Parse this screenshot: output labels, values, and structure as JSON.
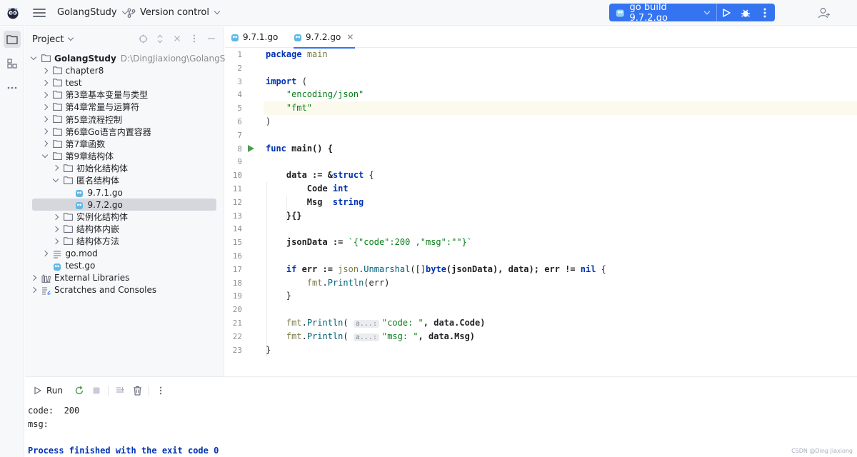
{
  "titlebar": {
    "project_name": "GolangStudy",
    "vcs_label": "Version control",
    "run_config": "go build 9.7.2.go"
  },
  "project_panel": {
    "title": "Project",
    "tree": [
      {
        "label": "GolangStudy",
        "hint": "D:\\DingJiaxiong\\GolangStudy",
        "level": 0,
        "kind": "folder",
        "state": "expanded"
      },
      {
        "label": "chapter8",
        "level": 1,
        "kind": "folder",
        "state": "collapsed"
      },
      {
        "label": "test",
        "level": 1,
        "kind": "folder",
        "state": "collapsed"
      },
      {
        "label": "第3章基本变量与类型",
        "level": 1,
        "kind": "folder",
        "state": "collapsed"
      },
      {
        "label": "第4章常量与运算符",
        "level": 1,
        "kind": "folder",
        "state": "collapsed"
      },
      {
        "label": "第5章流程控制",
        "level": 1,
        "kind": "folder",
        "state": "collapsed"
      },
      {
        "label": "第6章Go语言内置容器",
        "level": 1,
        "kind": "folder",
        "state": "collapsed"
      },
      {
        "label": "第7章函数",
        "level": 1,
        "kind": "folder",
        "state": "collapsed"
      },
      {
        "label": "第9章结构体",
        "level": 1,
        "kind": "folder",
        "state": "expanded"
      },
      {
        "label": "初始化结构体",
        "level": 2,
        "kind": "folder",
        "state": "collapsed"
      },
      {
        "label": "匿名结构体",
        "level": 2,
        "kind": "folder",
        "state": "expanded"
      },
      {
        "label": "9.7.1.go",
        "level": 3,
        "kind": "go",
        "state": "none"
      },
      {
        "label": "9.7.2.go",
        "level": 3,
        "kind": "go",
        "state": "none",
        "selected": true
      },
      {
        "label": "实例化结构体",
        "level": 2,
        "kind": "folder",
        "state": "collapsed"
      },
      {
        "label": "结构体内嵌",
        "level": 2,
        "kind": "folder",
        "state": "collapsed"
      },
      {
        "label": "结构体方法",
        "level": 2,
        "kind": "folder",
        "state": "collapsed"
      },
      {
        "label": "go.mod",
        "level": 1,
        "kind": "mod",
        "state": "collapsed"
      },
      {
        "label": "test.go",
        "level": 1,
        "kind": "go",
        "state": "none"
      },
      {
        "label": "External Libraries",
        "level": 0,
        "kind": "lib",
        "state": "collapsed"
      },
      {
        "label": "Scratches and Consoles",
        "level": 0,
        "kind": "scratch",
        "state": "collapsed"
      }
    ]
  },
  "editor": {
    "tabs": [
      {
        "label": "9.7.1.go",
        "active": false
      },
      {
        "label": "9.7.2.go",
        "active": true
      }
    ],
    "line_numbers": [
      "1",
      "2",
      "3",
      "4",
      "5",
      "6",
      "7",
      "8",
      "9",
      "10",
      "11",
      "12",
      "13",
      "14",
      "15",
      "16",
      "17",
      "18",
      "19",
      "20",
      "21",
      "22",
      "23"
    ],
    "hint_label": "a...:",
    "code": {
      "l1": [
        "package",
        "main"
      ],
      "l3": [
        "import",
        "("
      ],
      "l4": "\"encoding/json\"",
      "l5": "\"fmt\"",
      "l6": ")",
      "l8": [
        "func",
        "main() {"
      ],
      "l10": [
        "data := &",
        "struct",
        " {"
      ],
      "l11": [
        "Code ",
        "int"
      ],
      "l12": [
        "Msg  ",
        "string"
      ],
      "l13": "}{}",
      "l15": [
        "jsonData := ",
        "`{\"code\":200 ,\"msg\":\"\"}`"
      ],
      "l17": [
        "if",
        " err := ",
        "json",
        ".",
        "Unmarshal",
        "([]",
        "byte",
        "(jsonData), data); err != ",
        "nil",
        " {"
      ],
      "l18": [
        "fmt",
        ".",
        "Println",
        "(err)"
      ],
      "l19": "}",
      "l21": [
        "fmt",
        ".",
        "Println",
        "( ",
        "\"code: \"",
        ", data.Code)"
      ],
      "l22": [
        "fmt",
        ".",
        "Println",
        "( ",
        "\"msg: \"",
        ", data.Msg)"
      ],
      "l23": "}"
    }
  },
  "run_panel": {
    "tab_label": "Run",
    "output": [
      "code:  200",
      "msg:",
      "Process finished with the exit code 0"
    ]
  },
  "watermark": "CSDN @Ding Jiaxiong",
  "colors": {
    "accent": "#3574f0",
    "keyword": "#0033b3",
    "string": "#067d17",
    "function": "#00627a",
    "package": "#7a7a43"
  }
}
